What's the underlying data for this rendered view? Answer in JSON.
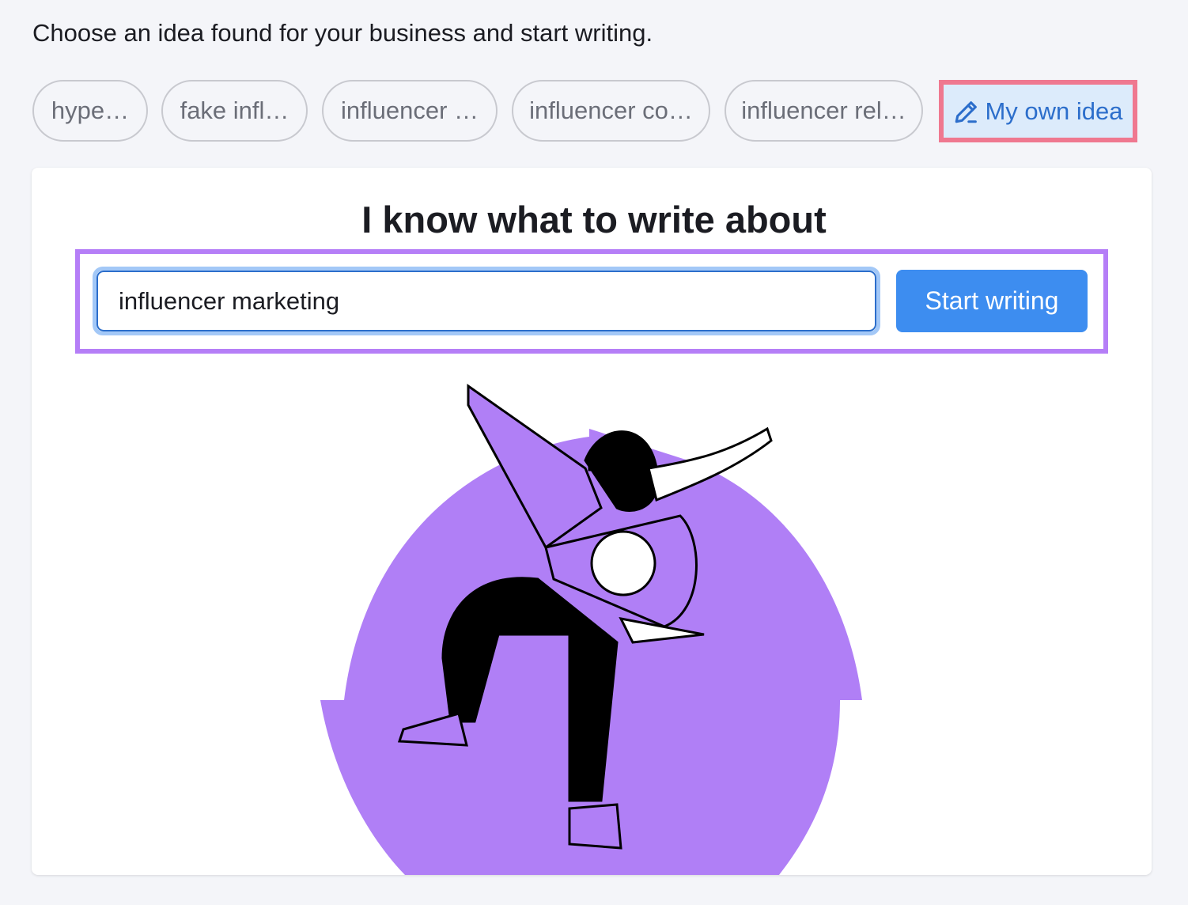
{
  "intro": "Choose an idea found for your business and start writing.",
  "ideas": [
    {
      "label": "hype…"
    },
    {
      "label": "fake infl…"
    },
    {
      "label": "influencer …"
    },
    {
      "label": "influencer co…"
    },
    {
      "label": "influencer rel…"
    }
  ],
  "own_idea": {
    "label": "My own idea",
    "icon": "pencil-icon"
  },
  "card": {
    "title": "I know what to write about",
    "input_value": "influencer marketing",
    "button_label": "Start writing"
  },
  "colors": {
    "accent": "#3d8df0",
    "illustration": "#b07ff6",
    "highlight_red": "#ef7890",
    "highlight_purple": "#b57ef7"
  }
}
